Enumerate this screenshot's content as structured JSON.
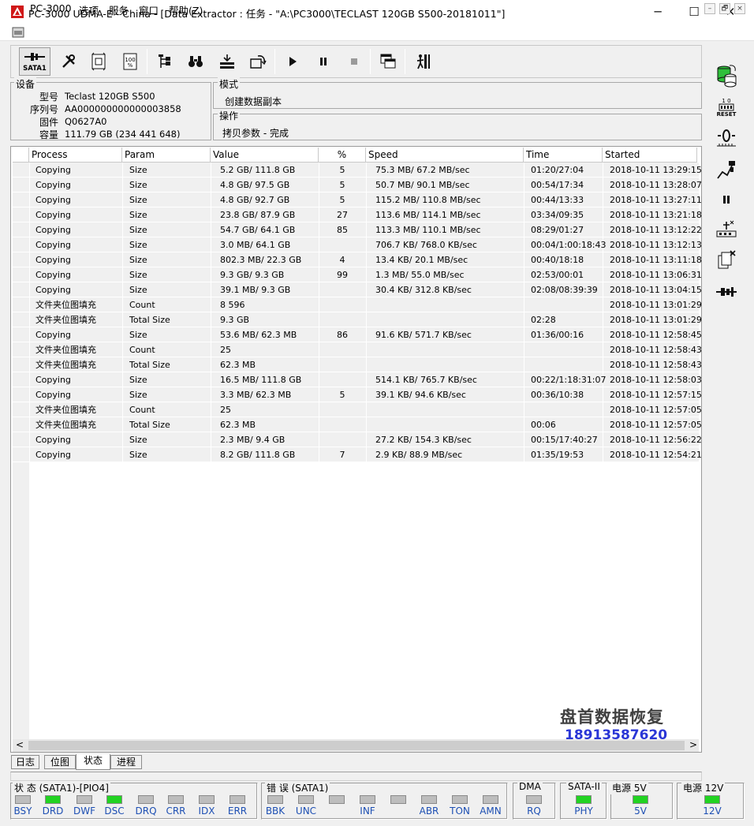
{
  "window": {
    "title": "PC-3000 UDMA-E - China - [Data Extractor : 任务 - \"A:\\PC3000\\TECLAST 120GB S500-20181011\"]",
    "minimize": "─",
    "maximize": "☐",
    "close": "✕"
  },
  "menu": {
    "items": [
      "PC-3000",
      "选项",
      "服务",
      "窗口",
      "帮助(Z)"
    ],
    "mdi_min": "–",
    "mdi_restore": "🗗",
    "mdi_close": "×"
  },
  "toolbar": {
    "sata_label": "SATA1",
    "icons": [
      "sata-connector-icon",
      "tools-icon",
      "drive-utility-icon",
      "percent-icon",
      "tree-icon",
      "binoculars-icon",
      "layers-icon",
      "export-icon",
      "play-icon",
      "pause-icon",
      "stop-icon",
      "window-copy-icon",
      "exit-icon"
    ]
  },
  "right_tools": [
    "disk-stack-icon",
    "reset-icon",
    "voltage-icon",
    "probe-icon",
    "pause-icon",
    "network-icon",
    "clone-close-icon",
    "connector-icon"
  ],
  "right_reset_label": "RESET",
  "device": {
    "group_title": "设备",
    "labels": {
      "model": "型号",
      "serial": "序列号",
      "firmware": "固件",
      "capacity": "容量"
    },
    "model": "Teclast 120GB S500",
    "serial": "AA000000000000003858",
    "firmware": "Q0627A0",
    "capacity": "111.79 GB (234 441 648)"
  },
  "mode": {
    "group_title": "模式",
    "value": "创建数据副本"
  },
  "operation": {
    "group_title": "操作",
    "value": "拷贝参数 - 完成"
  },
  "table": {
    "headers": {
      "process": "Process",
      "param": "Param",
      "value": "Value",
      "percent": "%",
      "speed": "Speed",
      "time": "Time",
      "started": "Started"
    },
    "rows": [
      {
        "process": "Copying",
        "param": "Size",
        "value": "5.2 GB/ 111.8 GB",
        "percent": "5",
        "speed": "75.3 MB/ 67.2 MB/sec",
        "time": "01:20/27:04",
        "started": "2018-10-11 13:29:15"
      },
      {
        "process": "Copying",
        "param": "Size",
        "value": "4.8 GB/ 97.5 GB",
        "percent": "5",
        "speed": "50.7 MB/ 90.1 MB/sec",
        "time": "00:54/17:34",
        "started": "2018-10-11 13:28:07"
      },
      {
        "process": "Copying",
        "param": "Size",
        "value": "4.8 GB/ 92.7 GB",
        "percent": "5",
        "speed": "115.2 MB/ 110.8 MB/sec",
        "time": "00:44/13:33",
        "started": "2018-10-11 13:27:11"
      },
      {
        "process": "Copying",
        "param": "Size",
        "value": "23.8 GB/ 87.9 GB",
        "percent": "27",
        "speed": "113.6 MB/ 114.1 MB/sec",
        "time": "03:34/09:35",
        "started": "2018-10-11 13:21:18"
      },
      {
        "process": "Copying",
        "param": "Size",
        "value": "54.7 GB/ 64.1 GB",
        "percent": "85",
        "speed": "113.3 MB/ 110.1 MB/sec",
        "time": "08:29/01:27",
        "started": "2018-10-11 13:12:22"
      },
      {
        "process": "Copying",
        "param": "Size",
        "value": "3.0 MB/ 64.1 GB",
        "percent": "",
        "speed": "706.7 KB/ 768.0 KB/sec",
        "time": "00:04/1:00:18:43",
        "started": "2018-10-11 13:12:13"
      },
      {
        "process": "Copying",
        "param": "Size",
        "value": "802.3 MB/ 22.3 GB",
        "percent": "4",
        "speed": "13.4 KB/ 20.1 MB/sec",
        "time": "00:40/18:18",
        "started": "2018-10-11 13:11:18"
      },
      {
        "process": "Copying",
        "param": "Size",
        "value": "9.3 GB/ 9.3 GB",
        "percent": "99",
        "speed": "1.3 MB/ 55.0 MB/sec",
        "time": "02:53/00:01",
        "started": "2018-10-11 13:06:31"
      },
      {
        "process": "Copying",
        "param": "Size",
        "value": "39.1 MB/ 9.3 GB",
        "percent": "",
        "speed": "30.4 KB/ 312.8 KB/sec",
        "time": "02:08/08:39:39",
        "started": "2018-10-11 13:04:15"
      },
      {
        "process": "文件夹位图填充",
        "param": "Count",
        "value": "8 596",
        "percent": "",
        "speed": "",
        "time": "",
        "started": "2018-10-11 13:01:29"
      },
      {
        "process": "文件夹位图填充",
        "param": "Total Size",
        "value": "9.3 GB",
        "percent": "",
        "speed": "",
        "time": "02:28",
        "started": "2018-10-11 13:01:29"
      },
      {
        "process": "Copying",
        "param": "Size",
        "value": "53.6 MB/ 62.3 MB",
        "percent": "86",
        "speed": "91.6 KB/ 571.7 KB/sec",
        "time": "01:36/00:16",
        "started": "2018-10-11 12:58:45"
      },
      {
        "process": "文件夹位图填充",
        "param": "Count",
        "value": "25",
        "percent": "",
        "speed": "",
        "time": "",
        "started": "2018-10-11 12:58:43"
      },
      {
        "process": "文件夹位图填充",
        "param": "Total Size",
        "value": "62.3 MB",
        "percent": "",
        "speed": "",
        "time": "",
        "started": "2018-10-11 12:58:43"
      },
      {
        "process": "Copying",
        "param": "Size",
        "value": "16.5 MB/ 111.8 GB",
        "percent": "",
        "speed": "514.1 KB/ 765.7 KB/sec",
        "time": "00:22/1:18:31:07",
        "started": "2018-10-11 12:58:03"
      },
      {
        "process": "Copying",
        "param": "Size",
        "value": "3.3 MB/ 62.3 MB",
        "percent": "5",
        "speed": "39.1 KB/ 94.6 KB/sec",
        "time": "00:36/10:38",
        "started": "2018-10-11 12:57:15"
      },
      {
        "process": "文件夹位图填充",
        "param": "Count",
        "value": "25",
        "percent": "",
        "speed": "",
        "time": "",
        "started": "2018-10-11 12:57:05"
      },
      {
        "process": "文件夹位图填充",
        "param": "Total Size",
        "value": "62.3 MB",
        "percent": "",
        "speed": "",
        "time": "00:06",
        "started": "2018-10-11 12:57:05"
      },
      {
        "process": "Copying",
        "param": "Size",
        "value": "2.3 MB/ 9.4 GB",
        "percent": "",
        "speed": "27.2 KB/ 154.3 KB/sec",
        "time": "00:15/17:40:27",
        "started": "2018-10-11 12:56:22"
      },
      {
        "process": "Copying",
        "param": "Size",
        "value": "8.2 GB/ 111.8 GB",
        "percent": "7",
        "speed": "2.9 KB/ 88.9 MB/sec",
        "time": "01:35/19:53",
        "started": "2018-10-11 12:54:21"
      }
    ]
  },
  "scroll": {
    "left": "<",
    "right": ">"
  },
  "tabs": [
    "日志",
    "位图",
    "状态",
    "进程"
  ],
  "active_tab": "状态",
  "status_panel": {
    "state": {
      "title": "状 态 (SATA1)-[PIO4]",
      "leds": [
        {
          "label": "BSY",
          "on": false
        },
        {
          "label": "DRD",
          "on": true
        },
        {
          "label": "DWF",
          "on": false
        },
        {
          "label": "DSC",
          "on": true
        },
        {
          "label": "DRQ",
          "on": false
        },
        {
          "label": "CRR",
          "on": false
        },
        {
          "label": "IDX",
          "on": false
        },
        {
          "label": "ERR",
          "on": false
        }
      ]
    },
    "error": {
      "title": "错 误 (SATA1)",
      "leds": [
        {
          "label": "BBK",
          "on": false
        },
        {
          "label": "UNC",
          "on": false
        },
        {
          "label": "",
          "on": false
        },
        {
          "label": "INF",
          "on": false
        },
        {
          "label": "",
          "on": false
        },
        {
          "label": "ABR",
          "on": false
        },
        {
          "label": "TON",
          "on": false
        },
        {
          "label": "AMN",
          "on": false
        }
      ]
    },
    "dma": {
      "title": "DMA",
      "leds": [
        {
          "label": "RQ",
          "on": false
        }
      ]
    },
    "sata": {
      "title": "SATA-II",
      "leds": [
        {
          "label": "PHY",
          "on": true
        }
      ]
    },
    "p5v": {
      "title": "电源 5V",
      "leds": [
        {
          "label": "5V",
          "on": true
        }
      ]
    },
    "p12v": {
      "title": "电源 12V",
      "leds": [
        {
          "label": "12V",
          "on": true
        }
      ]
    }
  },
  "colors": {
    "led_on": "#22d322",
    "led_off": "#bdbdbd",
    "label_blue": "#1d4fb3",
    "watermark_blue": "#2a36d6"
  },
  "watermark": {
    "line1": "盘首数据恢复",
    "line2": "18913587620"
  }
}
